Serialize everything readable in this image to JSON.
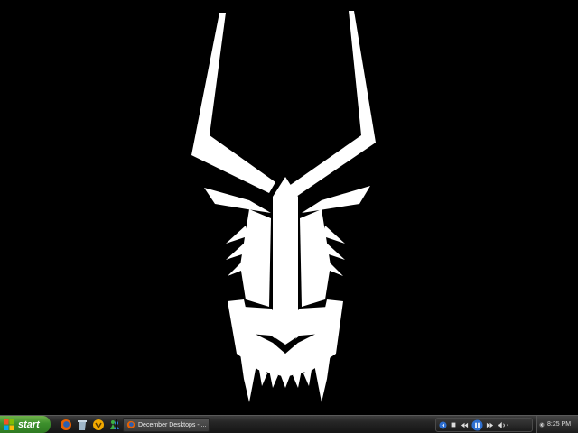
{
  "taskbar": {
    "start_label": "start",
    "task_window_title": "December Desktops - ...",
    "clock": "8:25 PM"
  },
  "icons": {
    "quick_launch": [
      "firefox-icon",
      "recycle-bin-icon",
      "winamp-icon",
      "messenger-icon"
    ],
    "media": [
      "previous-icon",
      "stop-icon",
      "rewind-icon",
      "pause-icon",
      "forward-icon",
      "volume-icon"
    ],
    "tray": [
      "tray-show-icon"
    ]
  },
  "colors": {
    "desktop_background": "#000000",
    "wallpaper_figure": "#ffffff",
    "start_button": "#3c8f2c",
    "taskbar": "#262626"
  }
}
